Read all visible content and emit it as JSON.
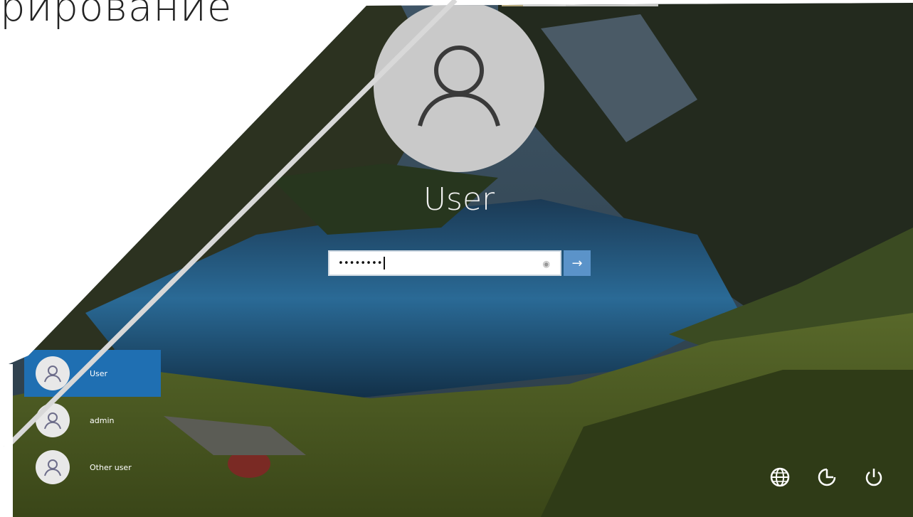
{
  "heading": {
    "text": "рирование"
  },
  "lock_screen": {
    "user_name": "User",
    "password": {
      "masked_value": "••••••••",
      "reveal_icon": "eye-icon"
    },
    "submit": {
      "icon": "arrow-right-icon",
      "label": "→"
    },
    "users": [
      {
        "label": "User",
        "selected": true
      },
      {
        "label": "admin",
        "selected": false
      },
      {
        "label": "Other user",
        "selected": false
      }
    ],
    "bottom_icons": [
      {
        "name": "network-icon"
      },
      {
        "name": "ease-of-access-icon"
      },
      {
        "name": "power-icon"
      }
    ]
  },
  "colors": {
    "selected_user": "#1f6fb2",
    "submit_button": "#5b93c9",
    "avatar": "#c9c9c9"
  }
}
